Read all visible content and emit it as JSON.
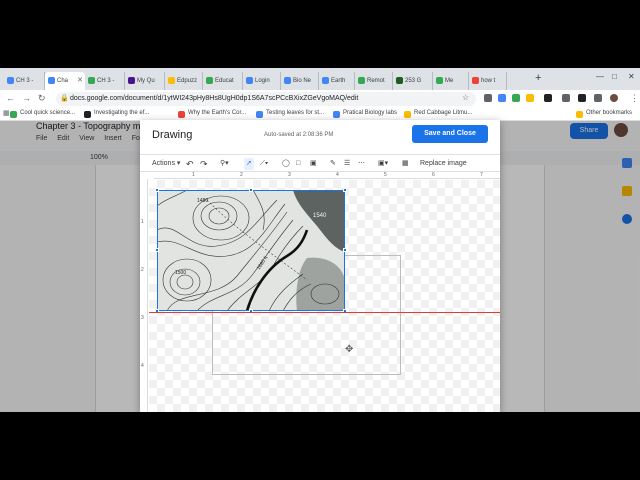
{
  "browser": {
    "tabs": [
      {
        "label": "CH 3 -",
        "color": "#4285f4",
        "active": false
      },
      {
        "label": "Cha",
        "color": "#4285f4",
        "active": true
      },
      {
        "label": "CH 3 -",
        "color": "#34a853",
        "active": false
      },
      {
        "label": "My Qu",
        "color": "#4a148c",
        "active": false
      },
      {
        "label": "Edpuzz",
        "color": "#fbbc04",
        "active": false
      },
      {
        "label": "Educat",
        "color": "#34a853",
        "active": false
      },
      {
        "label": "Login",
        "color": "#4285f4",
        "active": false
      },
      {
        "label": "Bio Ne",
        "color": "#4285f4",
        "active": false
      },
      {
        "label": "Earth",
        "color": "#4285f4",
        "active": false
      },
      {
        "label": "Remot",
        "color": "#34a853",
        "active": false
      },
      {
        "label": "253 G",
        "color": "#1b5e20",
        "active": false
      },
      {
        "label": "Me",
        "color": "#34a853",
        "active": false
      },
      {
        "label": "how t",
        "color": "#ea4335",
        "active": false
      }
    ],
    "new_tab_label": "+",
    "url": "docs.google.com/document/d/1ytWI243pHy8Hs8UgH0dp1S6A7scPCcBXixZGeVgoMAQ/edit",
    "bookmarks": [
      {
        "label": "Cool quick science...",
        "color": "#34a853"
      },
      {
        "label": "Investigating the ef...",
        "color": "#202124"
      },
      {
        "label": "Why the Earth's Cor...",
        "color": "#ea4335"
      },
      {
        "label": "Testing leaves for st...",
        "color": "#4285f4"
      },
      {
        "label": "Pratical Biology labs",
        "color": "#4285f4"
      },
      {
        "label": "Red Cabbage Litmu...",
        "color": "#fbbc04"
      },
      {
        "label": "Other bookmarks",
        "color": "#fbbc04"
      }
    ]
  },
  "docs": {
    "title": "Chapter 3 - Topography m",
    "menu": [
      "File",
      "Edit",
      "View",
      "Insert",
      "Forma"
    ],
    "zoom": "100%",
    "share_label": "Share"
  },
  "drawing": {
    "title": "Drawing",
    "autosave": "Auto-saved at 2:08:36 PM",
    "save_close": "Save and Close",
    "actions_label": "Actions",
    "replace_image": "Replace image",
    "ruler_h": [
      "1",
      "2",
      "3",
      "4",
      "5",
      "6",
      "7"
    ],
    "ruler_v": [
      "1",
      "2",
      "3",
      "4"
    ]
  },
  "map": {
    "labels": [
      "1540",
      "1480",
      "1680 ft",
      "1500"
    ]
  },
  "colors": {
    "accent": "#1a73e8",
    "guide": "#e53935"
  }
}
